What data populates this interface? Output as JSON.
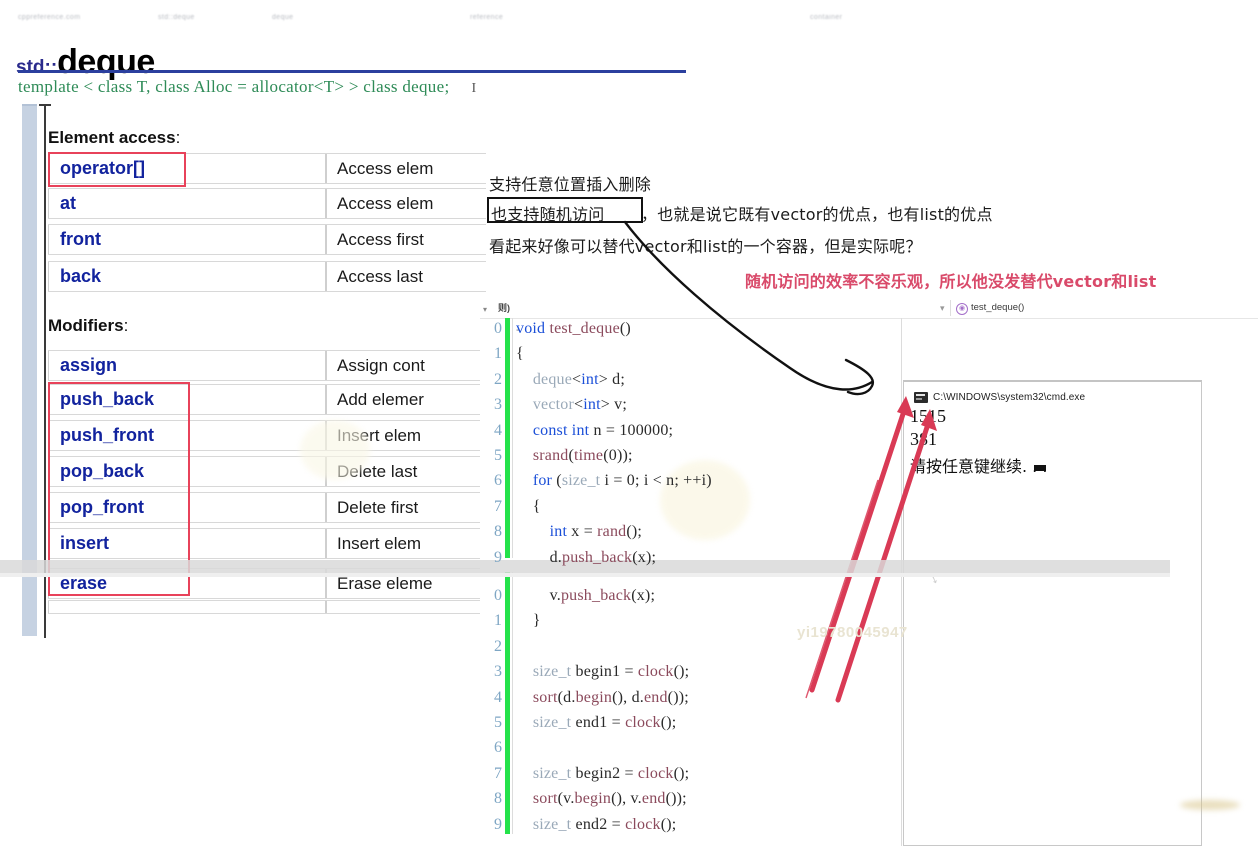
{
  "document": {
    "topbar_fragments": [
      "cppreference.com",
      "std::deque",
      "deque",
      "reference",
      "container"
    ],
    "namespace": "std::",
    "name": "deque",
    "template_signature": "template < class T, class Alloc = allocator<T> > class deque;",
    "cursor_glyph": "I",
    "sections": [
      {
        "heading": "Element access",
        "heading_colon": ":",
        "rows": [
          {
            "name": "operator[]",
            "desc": "Access elem",
            "highlight": true
          },
          {
            "name": "at",
            "desc": "Access elem",
            "highlight": false
          },
          {
            "name": "front",
            "desc": "Access first",
            "highlight": false
          },
          {
            "name": "back",
            "desc": "Access last",
            "highlight": false
          }
        ]
      },
      {
        "heading": "Modifiers",
        "heading_colon": ":",
        "rows": [
          {
            "name": "assign",
            "desc": "Assign cont",
            "highlight": false
          },
          {
            "name": "push_back",
            "desc": "Add elemer",
            "highlight": true
          },
          {
            "name": "push_front",
            "desc": "Insert elem",
            "highlight": true
          },
          {
            "name": "pop_back",
            "desc": "Delete last",
            "highlight": true
          },
          {
            "name": "pop_front",
            "desc": "Delete first",
            "highlight": true
          },
          {
            "name": "insert",
            "desc": "Insert elem",
            "highlight": true
          },
          {
            "name": "erase",
            "desc": "Erase eleme",
            "highlight": true
          }
        ]
      }
    ]
  },
  "annotations": {
    "line1": "支持任意位置插入删除",
    "line2_boxed": "也支持随机访问",
    "line2_rest": "，也就是说它既有vector的优点，也有list的优点",
    "line3": "看起来好像可以替代vector和list的一个容器，但是实际呢？",
    "line4_red": "随机访问的效率不容乐观，所以他没发替代vector和list",
    "watermark": "yi19780045947"
  },
  "ide": {
    "scope_label": "则)",
    "function_name": "test_deque()",
    "function_icon": "method-icon",
    "gutter_numbers": [
      "0",
      "1",
      "2",
      "3",
      "4",
      "5",
      "6",
      "7",
      "8",
      "9",
      "0",
      "1",
      "2",
      "3",
      "4",
      "5",
      "6",
      "7",
      "8",
      "9"
    ],
    "code_lines": [
      "void test_deque()",
      "{",
      "    deque<int> d;",
      "    vector<int> v;",
      "    const int n = 100000;",
      "    srand(time(0));",
      "    for (size_t i = 0; i < n; ++i)",
      "    {",
      "        int x = rand();",
      "        d.push_back(x);",
      "        v.push_back(x);",
      "    }",
      "",
      "    size_t begin1 = clock();",
      "    sort(d.begin(), d.end());",
      "    size_t end1 = clock();",
      "",
      "    size_t begin2 = clock();",
      "    sort(v.begin(), v.end());",
      "    size_t end2 = clock();"
    ],
    "collapse_marker": "-"
  },
  "console": {
    "title": "C:\\WINDOWS\\system32\\cmd.exe",
    "icon": "cmd-icon",
    "lines": [
      "1515",
      "381",
      "请按任意键继续. . ."
    ]
  },
  "colors": {
    "doc_rule": "#2b3f9e",
    "member_name": "#12239e",
    "highlight_box": "#e8425a",
    "template_text": "#2e8b57",
    "red_annotation": "#d94a6a",
    "changebar_green": "#24e24a",
    "red_arrow": "#d93a55",
    "left_rail": "#c6d2e2"
  }
}
